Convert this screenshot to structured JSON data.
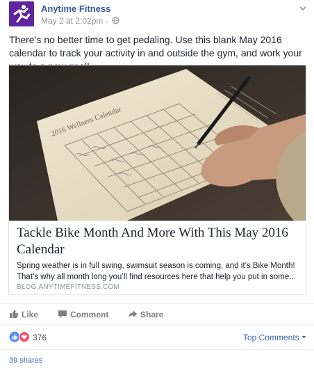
{
  "post": {
    "page_name": "Anytime Fitness",
    "timestamp": "May 2 at 2:02pm",
    "separator": "·",
    "text": "There’s no better time to get pedaling. Use this blank May 2016 calendar to track your activity in and outside the gym, and work your way to a new goal!",
    "privacy_icon": "globe-icon",
    "menu_icon": "chevron-down-icon"
  },
  "link_card": {
    "image_caption": "2016 Wellness Calendar",
    "title": "Tackle Bike Month And More With This May 2016 Calendar",
    "description": "Spring weather is in full swing, swimsuit season is coming, and it’s Bike Month! That’s why all month long you’ll find resources here that help you put in some...",
    "domain": "BLOG.ANYTIMEFITNESS.COM"
  },
  "actions": {
    "like": "Like",
    "comment": "Comment",
    "share": "Share"
  },
  "reactions": {
    "count": "376",
    "types": [
      "like",
      "love"
    ],
    "top_comments": "Top Comments"
  },
  "shares": "39 shares",
  "colors": {
    "brand_purple": "#5f259f",
    "link_blue": "#365899",
    "accent_blue": "#4267b2",
    "meta_gray": "#90949c",
    "like_blue": "#5890ff",
    "love_red": "#f25268"
  }
}
